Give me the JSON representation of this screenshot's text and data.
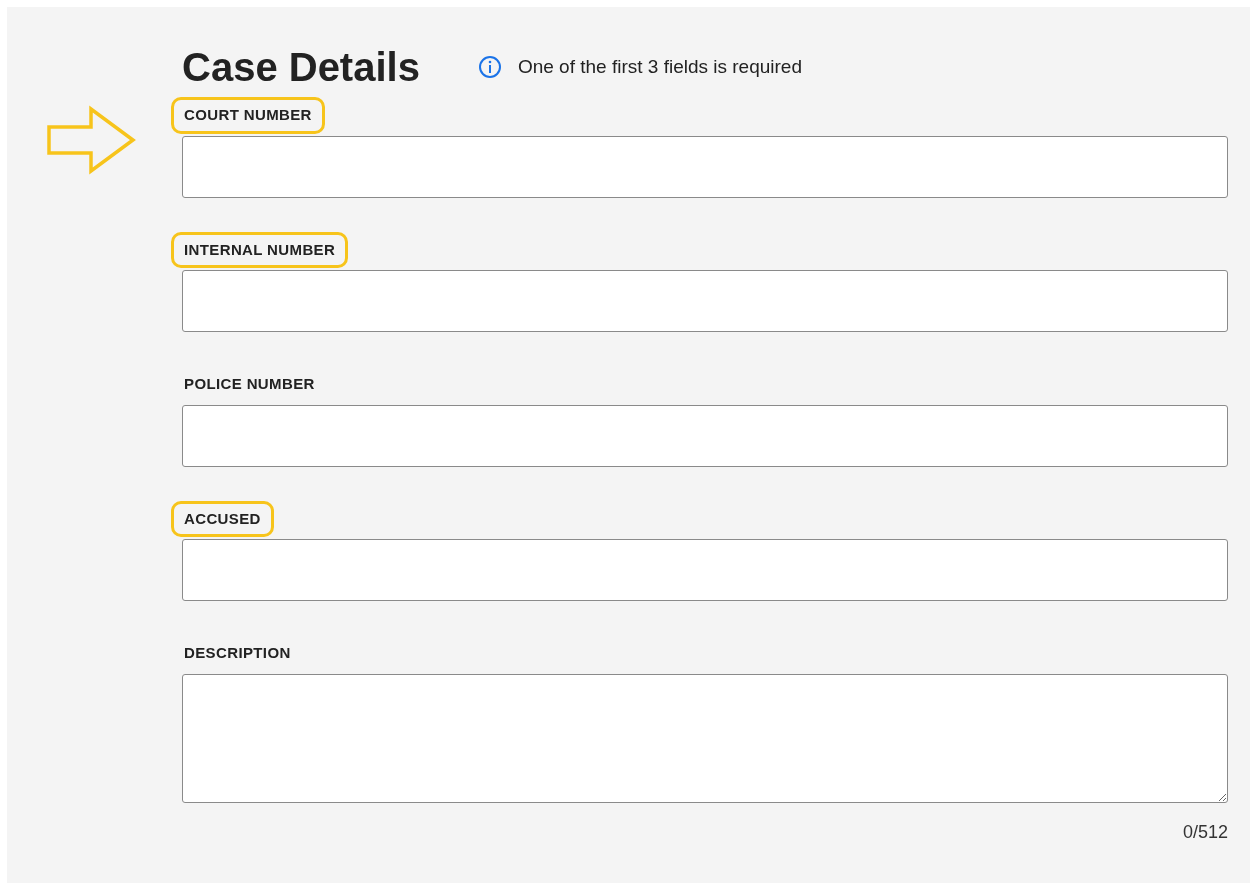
{
  "title": "Case Details",
  "notice": "One of the first 3 fields is required",
  "pointer_arrow": true,
  "fields": [
    {
      "label": "COURT NUMBER",
      "kind": "input",
      "highlighted": true
    },
    {
      "label": "INTERNAL NUMBER",
      "kind": "input",
      "highlighted": true
    },
    {
      "label": "POLICE NUMBER",
      "kind": "input",
      "highlighted": false
    },
    {
      "label": "ACCUSED",
      "kind": "input",
      "highlighted": true
    },
    {
      "label": "DESCRIPTION",
      "kind": "textarea",
      "highlighted": false,
      "counter": "0/512"
    }
  ]
}
